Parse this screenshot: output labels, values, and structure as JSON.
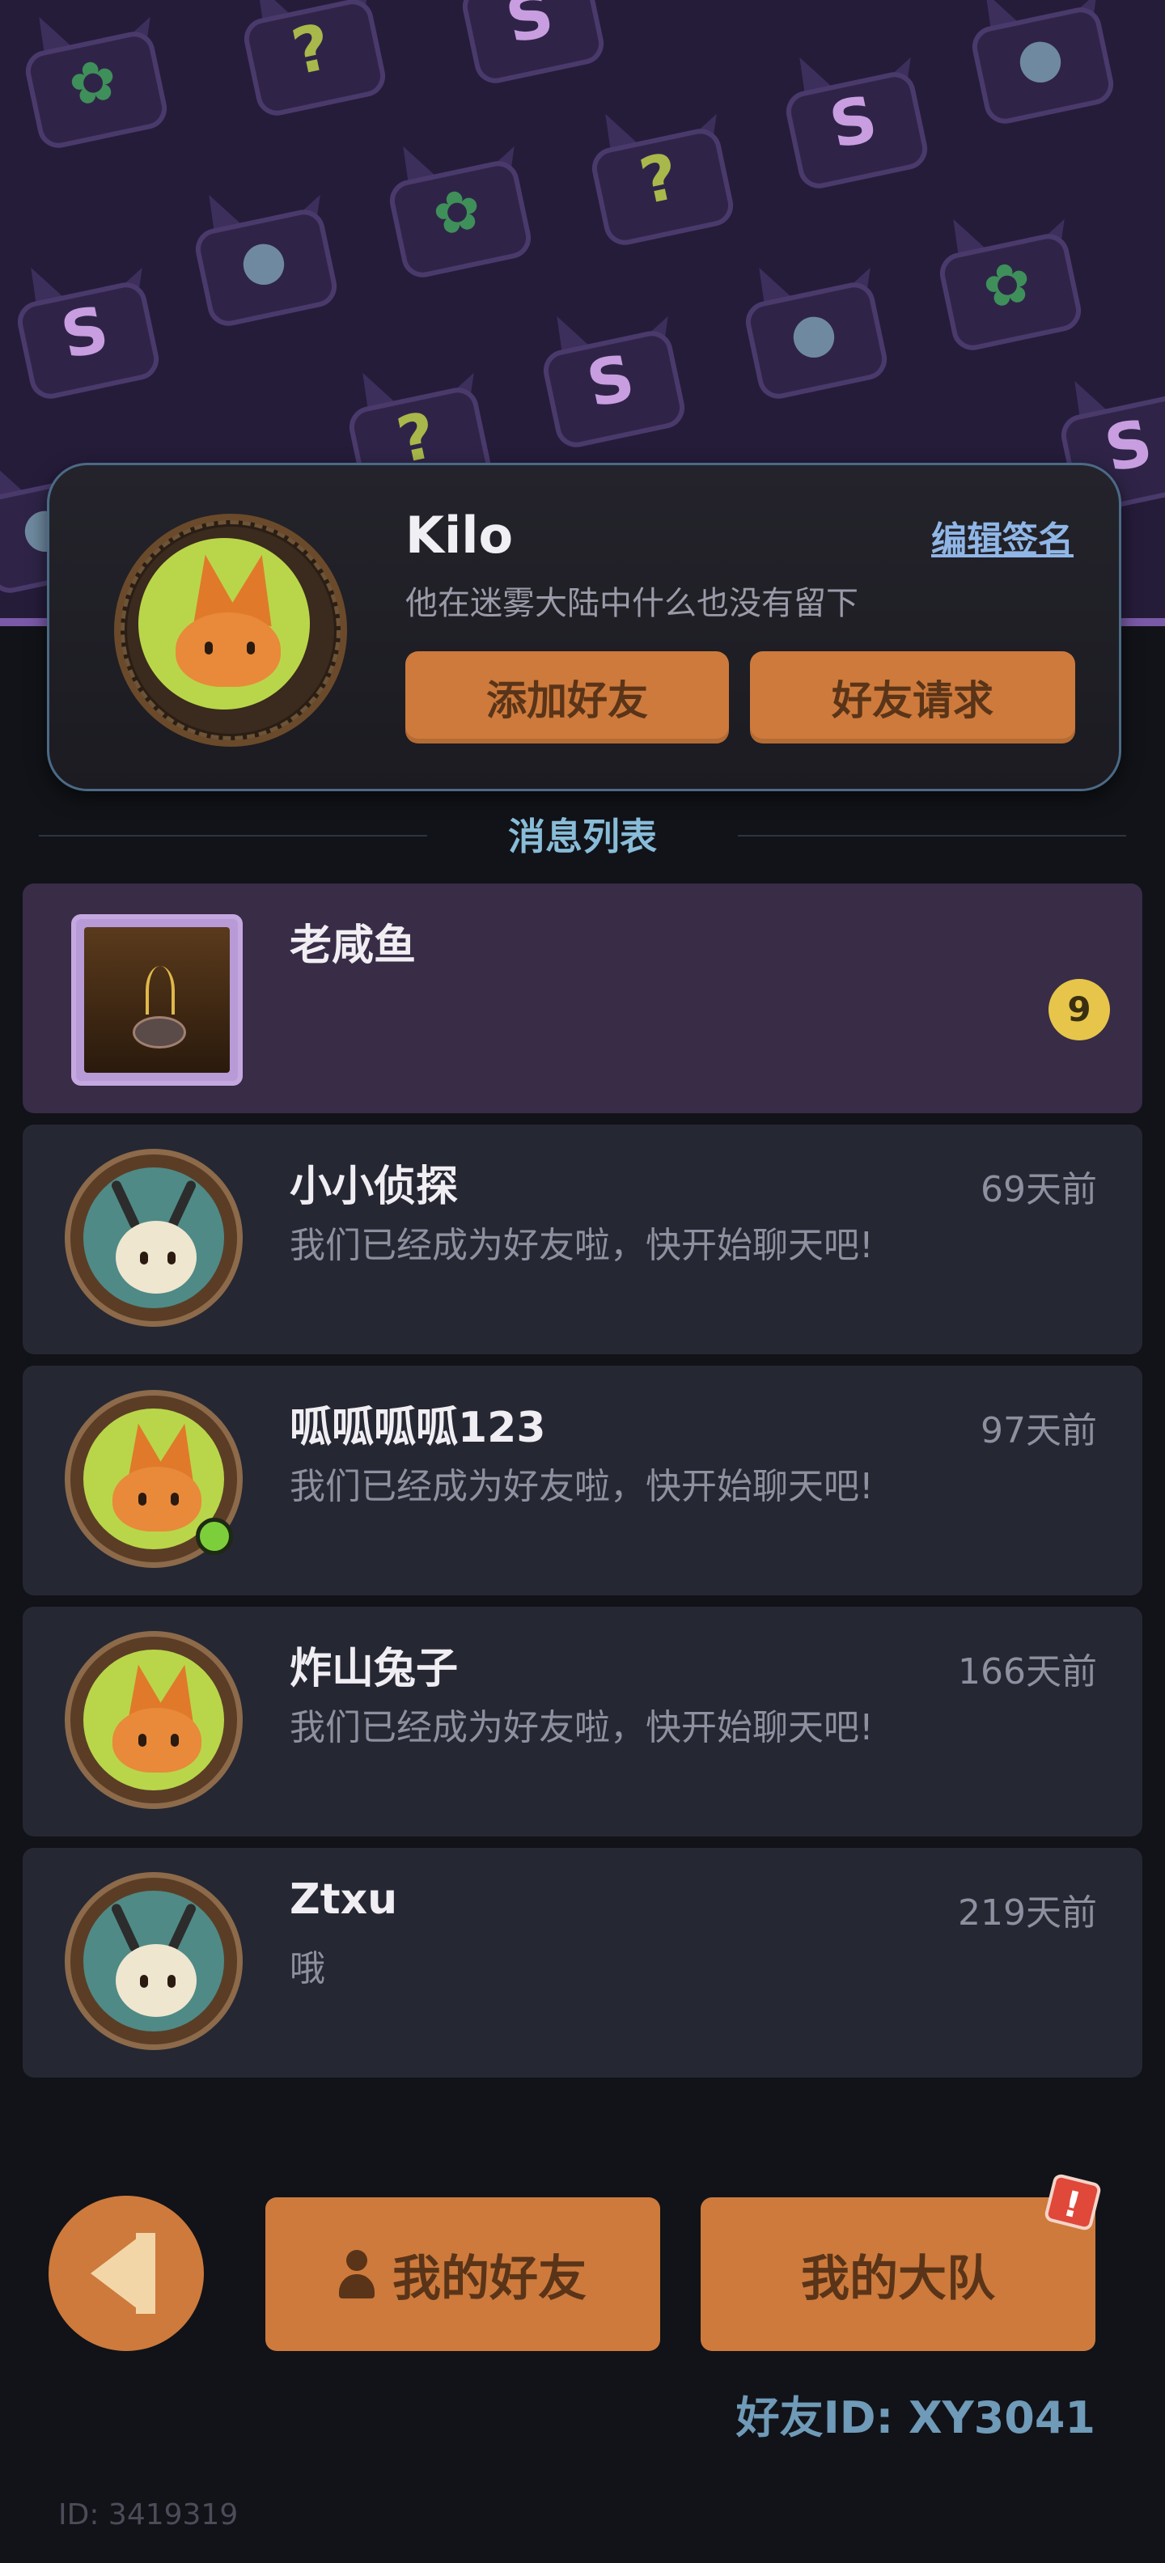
{
  "banner": {
    "pattern": [
      {
        "glyph": "✿",
        "kind": "leaf"
      },
      {
        "glyph": "?",
        "kind": "q"
      },
      {
        "glyph": "S",
        "kind": "s"
      },
      {
        "glyph": "●",
        "kind": "eye"
      },
      {
        "glyph": "●",
        "kind": "eye"
      },
      {
        "glyph": "●",
        "kind": "eye"
      },
      {
        "glyph": "✿",
        "kind": "leaf"
      },
      {
        "glyph": "?",
        "kind": "q"
      },
      {
        "glyph": "S",
        "kind": "s"
      },
      {
        "glyph": "✿",
        "kind": "leaf"
      },
      {
        "glyph": "S",
        "kind": "s"
      },
      {
        "glyph": "?",
        "kind": "q"
      },
      {
        "glyph": "S",
        "kind": "s"
      },
      {
        "glyph": "●",
        "kind": "eye"
      },
      {
        "glyph": "S",
        "kind": "s"
      }
    ]
  },
  "profile": {
    "name": "Kilo",
    "edit_sign": "编辑签名",
    "bio": "他在迷雾大陆中什么也没有留下",
    "add_friend": "添加好友",
    "friend_requests": "好友请求"
  },
  "section_title": "消息列表",
  "messages": [
    {
      "name": "老咸鱼",
      "text": "",
      "time": "",
      "unread": "9",
      "avatar": "square"
    },
    {
      "name": "小小侦探",
      "text": "我们已经成为好友啦，快开始聊天吧!",
      "time": "69天前",
      "avatar": "deer"
    },
    {
      "name": "呱呱呱呱123",
      "text": "我们已经成为好友啦，快开始聊天吧!",
      "time": "97天前",
      "avatar": "fox",
      "online": true
    },
    {
      "name": "炸山兔子",
      "text": "我们已经成为好友啦，快开始聊天吧!",
      "time": "166天前",
      "avatar": "fox"
    },
    {
      "name": "Ztxu",
      "text": "哦",
      "time": "219天前",
      "avatar": "deer"
    }
  ],
  "bottom": {
    "my_friends": "我的好友",
    "my_team": "我的大队",
    "alert": "!",
    "friend_id": "好友ID: XY3041",
    "footer_id": "ID: 3419319"
  },
  "colors": {
    "accent_orange": "#cd7a3c",
    "banner_bg": "#251c3a",
    "card_bg": "#252733",
    "highlight_bg": "#382c47",
    "title_blue": "#88bcd8",
    "online_green": "#7ccf3a",
    "badge_yellow": "#e6c54a"
  }
}
